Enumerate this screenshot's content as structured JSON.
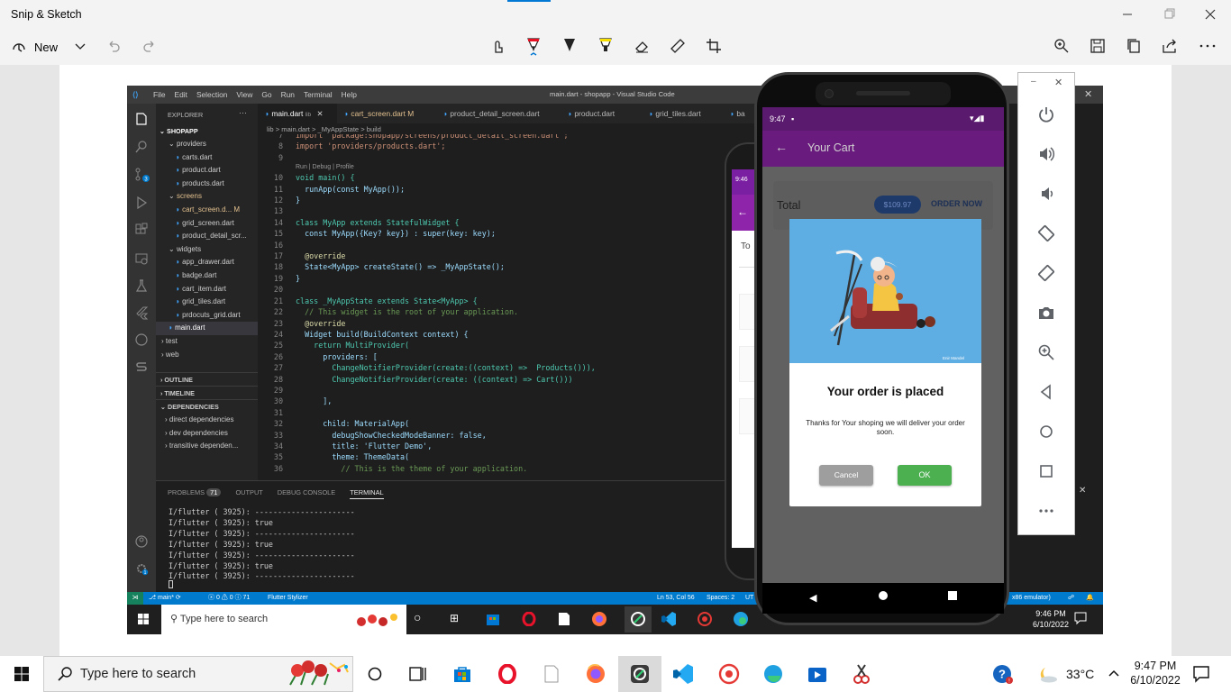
{
  "snip": {
    "title": "Snip & Sketch",
    "new_label": "New"
  },
  "vscode": {
    "menu": [
      "File",
      "Edit",
      "Selection",
      "View",
      "Go",
      "Run",
      "Terminal",
      "Help"
    ],
    "window_title": "main.dart - shopapp - Visual Studio Code",
    "explorer_label": "EXPLORER",
    "project": "SHOPAPP",
    "tabs": [
      {
        "label": "main.dart",
        "suffix": "lib"
      },
      {
        "label": "cart_screen.dart",
        "suffix": "M"
      },
      {
        "label": "product_detail_screen.dart",
        "suffix": ""
      },
      {
        "label": "product.dart",
        "suffix": ""
      },
      {
        "label": "grid_tiles.dart",
        "suffix": ""
      },
      {
        "label": "ba",
        "suffix": ""
      }
    ],
    "breadcrumb": "lib > main.dart > _MyAppState > build",
    "tree": [
      {
        "label": "providers",
        "indent": 1,
        "kind": "folder",
        "color": "#cccccc"
      },
      {
        "label": "carts.dart",
        "indent": 2,
        "kind": "file",
        "color": "#cccccc"
      },
      {
        "label": "product.dart",
        "indent": 2,
        "kind": "file",
        "color": "#cccccc"
      },
      {
        "label": "products.dart",
        "indent": 2,
        "kind": "file",
        "color": "#cccccc"
      },
      {
        "label": "screens",
        "indent": 1,
        "kind": "folder",
        "color": "#e2c08d"
      },
      {
        "label": "cart_screen.d...  M",
        "indent": 2,
        "kind": "file",
        "color": "#e2c08d"
      },
      {
        "label": "grid_screen.dart",
        "indent": 2,
        "kind": "file",
        "color": "#cccccc"
      },
      {
        "label": "product_detail_scr...",
        "indent": 2,
        "kind": "file",
        "color": "#cccccc"
      },
      {
        "label": "widgets",
        "indent": 1,
        "kind": "folder",
        "color": "#cccccc"
      },
      {
        "label": "app_drawer.dart",
        "indent": 2,
        "kind": "file",
        "color": "#cccccc"
      },
      {
        "label": "badge.dart",
        "indent": 2,
        "kind": "file",
        "color": "#cccccc"
      },
      {
        "label": "cart_item.dart",
        "indent": 2,
        "kind": "file",
        "color": "#cccccc"
      },
      {
        "label": "grid_tiles.dart",
        "indent": 2,
        "kind": "file",
        "color": "#cccccc"
      },
      {
        "label": "prdocuts_grid.dart",
        "indent": 2,
        "kind": "file",
        "color": "#cccccc"
      },
      {
        "label": "main.dart",
        "indent": 1,
        "kind": "file",
        "color": "#ffffff"
      },
      {
        "label": "test",
        "indent": 0,
        "kind": "folder",
        "color": "#cccccc"
      },
      {
        "label": "web",
        "indent": 0,
        "kind": "folder",
        "color": "#cccccc"
      }
    ],
    "sections": [
      "OUTLINE",
      "TIMELINE",
      "DEPENDENCIES"
    ],
    "deps": [
      "direct dependencies",
      "dev dependencies",
      "transitive dependen..."
    ],
    "code_lines": [
      {
        "n": "7",
        "t": "import 'package:shopapp/screens/product_detail_screen.dart';"
      },
      {
        "n": "8",
        "t": "import 'providers/products.dart';"
      },
      {
        "n": "9",
        "t": ""
      },
      {
        "n": "",
        "t": "Run | Debug | Profile"
      },
      {
        "n": "10",
        "t": "void main() {"
      },
      {
        "n": "11",
        "t": "  runApp(const MyApp());"
      },
      {
        "n": "12",
        "t": "}"
      },
      {
        "n": "13",
        "t": ""
      },
      {
        "n": "14",
        "t": "class MyApp extends StatefulWidget {"
      },
      {
        "n": "15",
        "t": "  const MyApp({Key? key}) : super(key: key);"
      },
      {
        "n": "16",
        "t": ""
      },
      {
        "n": "17",
        "t": "  @override"
      },
      {
        "n": "18",
        "t": "  State<MyApp> createState() => _MyAppState();"
      },
      {
        "n": "19",
        "t": "}"
      },
      {
        "n": "20",
        "t": ""
      },
      {
        "n": "21",
        "t": "class _MyAppState extends State<MyApp> {"
      },
      {
        "n": "22",
        "t": "  // This widget is the root of your application."
      },
      {
        "n": "23",
        "t": "  @override"
      },
      {
        "n": "24",
        "t": "  Widget build(BuildContext context) {"
      },
      {
        "n": "25",
        "t": "    return MultiProvider("
      },
      {
        "n": "26",
        "t": "      providers: ["
      },
      {
        "n": "27",
        "t": "        ChangeNotifierProvider(create:((context) =>  Products())),"
      },
      {
        "n": "28",
        "t": "        ChangeNotifierProvider(create: ((context) => Cart()))"
      },
      {
        "n": "29",
        "t": ""
      },
      {
        "n": "30",
        "t": "      ],"
      },
      {
        "n": "31",
        "t": ""
      },
      {
        "n": "32",
        "t": "      child: MaterialApp("
      },
      {
        "n": "33",
        "t": "        debugShowCheckedModeBanner: false,"
      },
      {
        "n": "34",
        "t": "        title: 'Flutter Demo',"
      },
      {
        "n": "35",
        "t": "        theme: ThemeData("
      },
      {
        "n": "36",
        "t": "          // This is the theme of your application."
      }
    ],
    "panel_tabs": [
      "PROBLEMS",
      "OUTPUT",
      "DEBUG CONSOLE",
      "TERMINAL"
    ],
    "problems_count": "71",
    "terminal_lines": [
      "I/flutter ( 3925): ----------------------",
      "I/flutter ( 3925): true",
      "I/flutter ( 3925): ----------------------",
      "I/flutter ( 3925): true",
      "I/flutter ( 3925): ----------------------",
      "I/flutter ( 3925): true",
      "I/flutter ( 3925): ----------------------"
    ],
    "status": {
      "branch": "main*",
      "problems": "ⓧ 0 ⚠ 0 ⓘ 71",
      "stylizer": "Flutter Stylizer",
      "position": "Ln 53, Col 56",
      "spaces": "Spaces: 2",
      "utf": "UT",
      "emulator": "x86 emulator)"
    }
  },
  "inner_taskbar": {
    "search": "Type here to search",
    "time": "9:46 PM",
    "date": "6/10/2022"
  },
  "phone_back": {
    "time": "9:46",
    "partial_text": "To"
  },
  "phone": {
    "time": "9:47",
    "appbar_title": "Your Cart",
    "total_label": "Total",
    "total_value": "$109.97",
    "order_now": "ORDER NOW",
    "dialog": {
      "credit": "Enir Mandel",
      "title": "Your order is placed",
      "message": "Thanks for Your shoping we will deliver your order soon.",
      "cancel": "Cancel",
      "ok": "OK"
    }
  },
  "taskbar": {
    "search_placeholder": "Type here to search",
    "temperature": "33°C",
    "time": "9:47 PM",
    "date": "6/10/2022"
  },
  "colors": {
    "accent_purple": "#7b1fa2",
    "ok_green": "#4caf50",
    "vscode_status": "#007acc"
  }
}
